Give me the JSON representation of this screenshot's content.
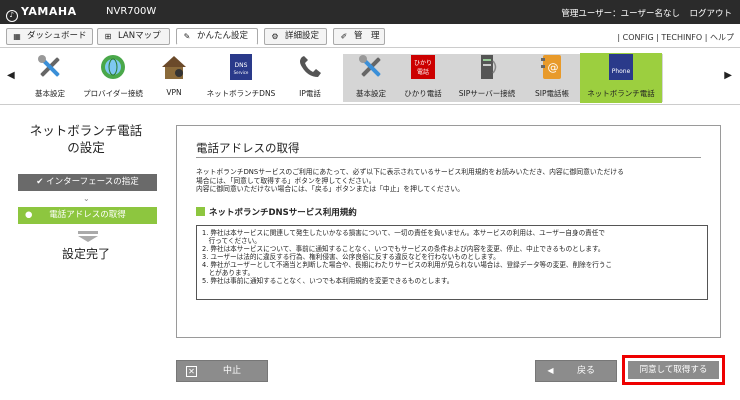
{
  "header": {
    "brand": "YAMAHA",
    "model": "NVR700W",
    "user_info": "管理ユーザー：ユーザー名なし",
    "logout": "ログアウト"
  },
  "tabs": [
    {
      "label": "ダッシュボード",
      "icon": "dashboard-icon"
    },
    {
      "label": "LANマップ",
      "icon": "lan-map-icon"
    },
    {
      "label": "かんたん設定",
      "icon": "wand-icon",
      "active": true
    },
    {
      "label": "詳細設定",
      "icon": "gear-icon"
    },
    {
      "label": "管　理",
      "icon": "wrench-icon"
    }
  ],
  "top_links": {
    "config": "CONFIG",
    "techinfo": "TECHINFO",
    "help": "ヘルプ"
  },
  "icon_bar": {
    "items": [
      {
        "label": "基本設定",
        "icon": "tools-icon"
      },
      {
        "label": "プロバイダー接続",
        "icon": "globe-icon"
      },
      {
        "label": "VPN",
        "icon": "vpn-house-icon"
      },
      {
        "label": "ネットボランチDNS",
        "icon": "dns-book-icon",
        "badge": "DNS\nService"
      },
      {
        "label": "IP電話",
        "icon": "phone-icon"
      },
      {
        "label": "基本設定",
        "icon": "tools-icon"
      },
      {
        "label": "ひかり電話",
        "icon": "hikari-denwa-icon",
        "badge": "ひかり\n電話"
      },
      {
        "label": "SIPサーバー接続",
        "icon": "server-icon"
      },
      {
        "label": "SIP電話帳",
        "icon": "phonebook-icon"
      },
      {
        "label": "ネットボランチ電話",
        "icon": "netvolante-phone-icon",
        "badge": "Phone",
        "selected": true
      }
    ],
    "accent": "#9ccf3f"
  },
  "left": {
    "title_line1": "ネットボランチ電話",
    "title_line2": "の設定",
    "step1": "インターフェースの指定",
    "step2": "電話アドレスの取得",
    "step3": "設定完了"
  },
  "panel": {
    "title": "電話アドレスの取得",
    "intro_1": "ネットボランチDNSサービスのご利用にあたって、必ず以下に表示されているサービス利用規約をお読みいただき、内容に御同意いただける",
    "intro_2": "場合には、「同意して取得する」ボタンを押してください。",
    "intro_3": "内容に御同意いただけない場合には、「戻る」ボタンまたは「中止」を押してください。",
    "terms_heading": "ネットボランチDNSサービス利用規約",
    "terms": [
      "1. 弊社は本サービスに関連して発生したいかなる損害について、一切の責任を負いません。本サービスの利用は、ユーザー自身の責任で",
      "　行ってください。",
      "2. 弊社は本サービスについて、事前に通知することなく、いつでもサービスの条件および内容を変更、停止、中止できるものとします。",
      "3. ユーザーは法的に違反する行為、権利侵害、公序良俗に反する違反などを行わないものとします。",
      "4. 弊社がユーザーとして不適当と判断した場合や、長期にわたりサービスの利用が見られない場合は、登録データ等の変更、削除を行うこ",
      "　とがあります。",
      "5. 弊社は事前に通知することなく、いつでも本利用規約を変更できるものとします。"
    ]
  },
  "buttons": {
    "cancel": "中止",
    "back": "戻る",
    "agree": "同意して取得する"
  },
  "colors": {
    "green": "#8dc63f",
    "highlight": "#ee0000",
    "button": "#8c8c8c",
    "topbar": "#2b2b2b"
  }
}
